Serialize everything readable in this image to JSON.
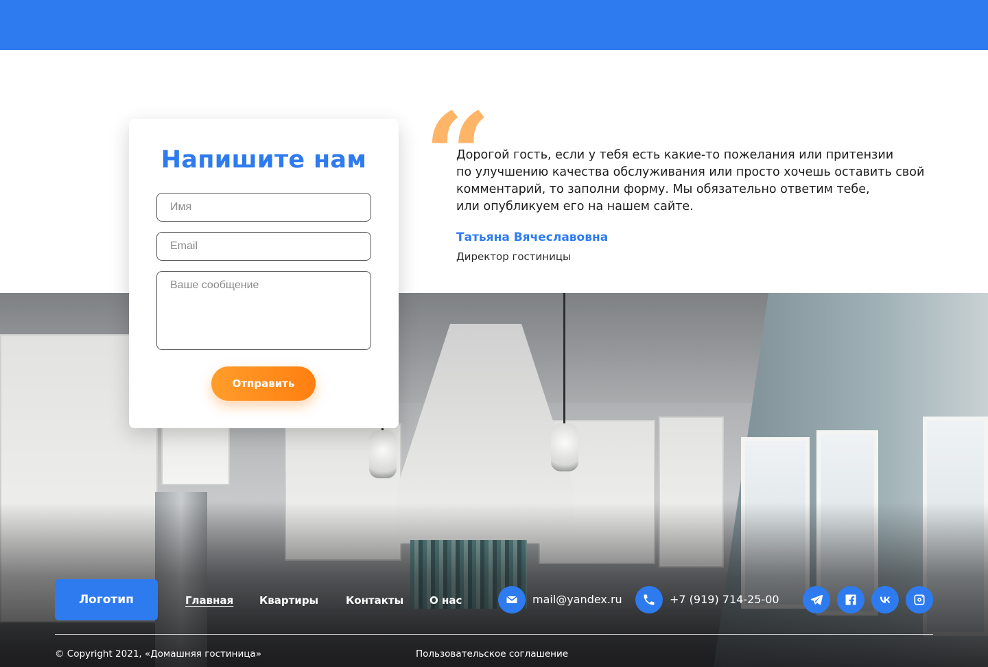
{
  "colors": {
    "brand_blue": "#2e7bef",
    "accent_orange": "#ff8a1c",
    "quote_mark": "#ffb568"
  },
  "form": {
    "title": "Напишите нам",
    "name_placeholder": "Имя",
    "email_placeholder": "Email",
    "message_placeholder": "Ваше сообщение",
    "submit_label": "Отправить"
  },
  "quote": {
    "lines": [
      "Дорогой гость, если у тебя есть какие-то пожелания или притензии",
      "по улучшению качества обслуживания или просто хочешь оставить свой",
      "комментарий, то заполни форму. Мы обязательно ответим тебе,",
      "или опубликуем его на нашем сайте."
    ],
    "author_name": "Татьяна Вячеславовна",
    "author_role": "Директор гостиницы"
  },
  "footer": {
    "logo": "Логотип",
    "nav": [
      {
        "label": "Главная",
        "active": true
      },
      {
        "label": "Квартиры",
        "active": false
      },
      {
        "label": "Контакты",
        "active": false
      },
      {
        "label": "О нас",
        "active": false
      }
    ],
    "email": "mail@yandex.ru",
    "phone": "+7 (919) 714-25-00",
    "social_icons": [
      "telegram-icon",
      "facebook-icon",
      "vk-icon",
      "instagram-icon"
    ],
    "copyright": "© Copyright 2021, «Домашняя гостиница»",
    "agreement": "Пользовательское соглашение"
  }
}
